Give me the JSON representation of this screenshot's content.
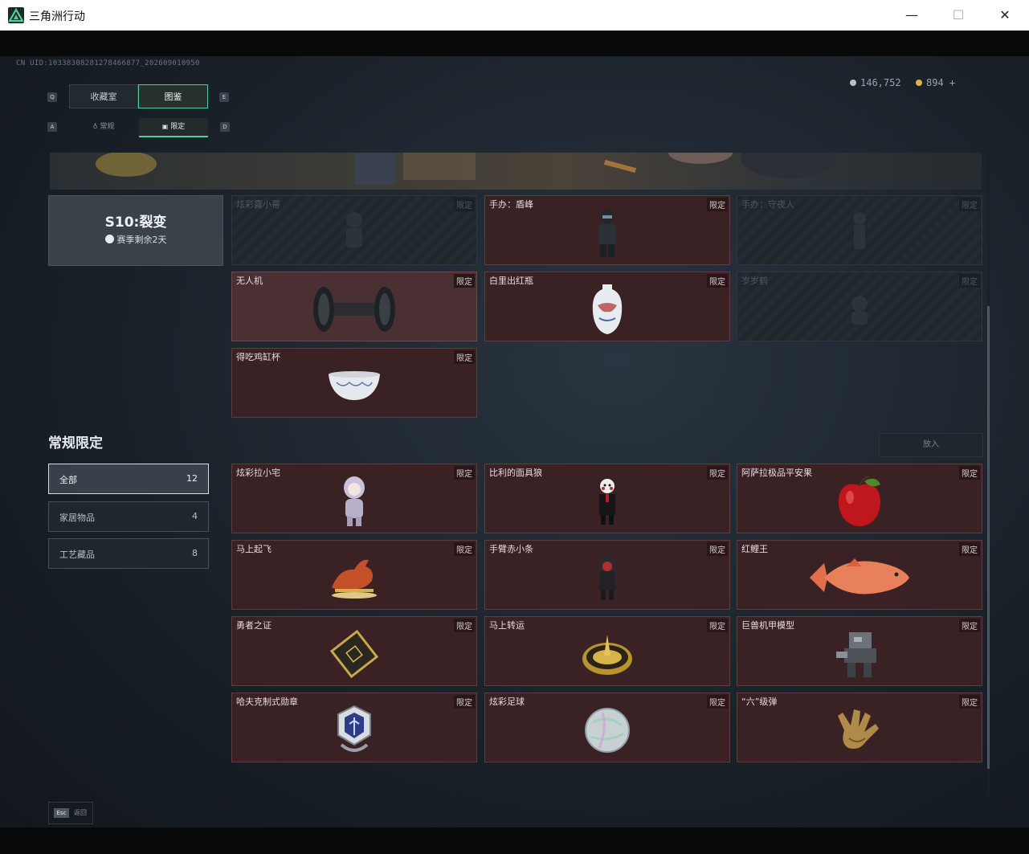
{
  "window": {
    "title": "三角洲行动",
    "minimize": "—",
    "maximize": "☐",
    "close": "✕"
  },
  "header": {
    "uid": "CN UID:10338308281278466877_202609010950",
    "currency": [
      {
        "value": "146,752",
        "color": "#b8c0c8"
      },
      {
        "value": "894 +",
        "color": "#d8b44a"
      }
    ],
    "tabs": [
      {
        "label": "收藏室",
        "active": false
      },
      {
        "label": "图鉴",
        "active": true
      }
    ],
    "tab_keys": {
      "left": "Q",
      "right": "E"
    },
    "subtabs": [
      {
        "label": "常规",
        "active": false
      },
      {
        "label": "限定",
        "active": true
      }
    ],
    "subtab_keys": {
      "left": "A",
      "right": "D"
    }
  },
  "season": {
    "title": "S10:裂变",
    "remaining": "赛季剩余2天"
  },
  "season_items": [
    {
      "name": "炫彩露小蒂",
      "badge": "限定",
      "state": "locked",
      "icon": "figure-icon"
    },
    {
      "name": "手办：盾峰",
      "badge": "限定",
      "state": "owned",
      "icon": "soldier-figure-icon"
    },
    {
      "name": "手办：守夜人",
      "badge": "限定",
      "state": "locked",
      "icon": "figure-icon"
    },
    {
      "name": "无人机",
      "badge": "限定",
      "state": "hover",
      "icon": "drone-icon"
    },
    {
      "name": "白里出红瓶",
      "badge": "限定",
      "state": "owned",
      "icon": "vase-icon"
    },
    {
      "name": "岁岁鹤",
      "badge": "限定",
      "state": "locked",
      "icon": "crane-icon"
    },
    {
      "name": "得吃鸡缸杯",
      "badge": "限定",
      "state": "owned",
      "icon": "bowl-icon"
    }
  ],
  "regular": {
    "title": "常规限定",
    "put_in": "放入",
    "filters": [
      {
        "label": "全部",
        "count": "12",
        "active": true
      },
      {
        "label": "家居物品",
        "count": "4",
        "active": false
      },
      {
        "label": "工艺藏品",
        "count": "8",
        "active": false
      }
    ],
    "items": [
      {
        "name": "炫彩拉小宅",
        "badge": "限定",
        "state": "owned",
        "icon": "doll-icon"
      },
      {
        "name": "比利的面具狼",
        "badge": "限定",
        "state": "owned",
        "icon": "puppet-icon"
      },
      {
        "name": "阿萨拉极品平安果",
        "badge": "限定",
        "state": "owned",
        "icon": "apple-icon"
      },
      {
        "name": "马上起飞",
        "badge": "限定",
        "state": "owned",
        "icon": "horse-icon"
      },
      {
        "name": "手臂赤小条",
        "badge": "限定",
        "state": "owned",
        "icon": "hooded-figure-icon"
      },
      {
        "name": "红鲤王",
        "badge": "限定",
        "state": "owned",
        "icon": "koi-fish-icon"
      },
      {
        "name": "勇者之证",
        "badge": "限定",
        "state": "owned",
        "icon": "card-icon"
      },
      {
        "name": "马上转运",
        "badge": "限定",
        "state": "owned",
        "icon": "compass-disc-icon"
      },
      {
        "name": "巨兽机甲模型",
        "badge": "限定",
        "state": "owned",
        "icon": "mech-icon"
      },
      {
        "name": "哈夫克制式勋章",
        "badge": "限定",
        "state": "owned",
        "icon": "medal-icon"
      },
      {
        "name": "炫彩足球",
        "badge": "限定",
        "state": "owned",
        "icon": "football-icon"
      },
      {
        "name": "“六”级弹",
        "badge": "限定",
        "state": "owned",
        "icon": "gold-hand-icon"
      }
    ]
  },
  "footer": {
    "esc_key": "Esc",
    "esc_label": "返回"
  },
  "colors": {
    "accent": "#4fcf9a",
    "owned_card": "#3a2124",
    "locked_card": "#1f262c"
  }
}
